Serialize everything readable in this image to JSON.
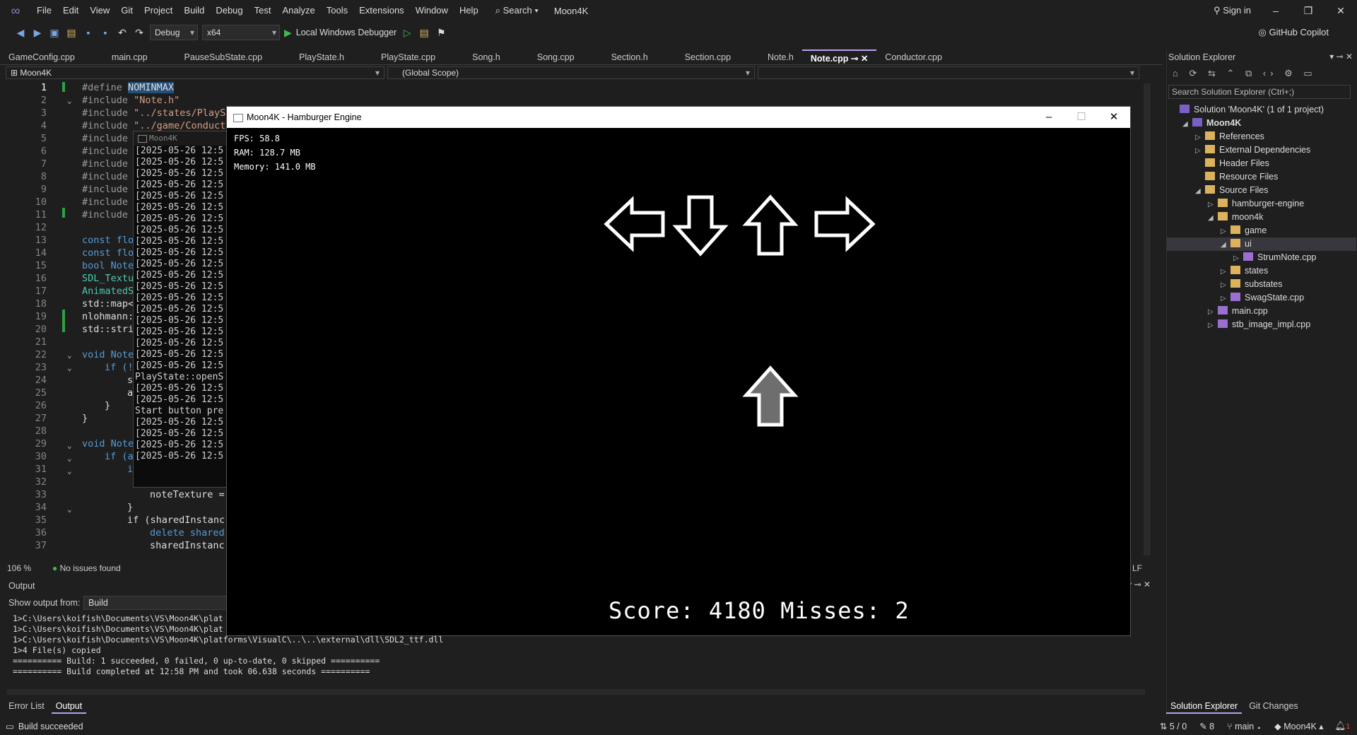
{
  "menu": [
    "File",
    "Edit",
    "View",
    "Git",
    "Project",
    "Build",
    "Debug",
    "Test",
    "Analyze",
    "Tools",
    "Extensions",
    "Window",
    "Help"
  ],
  "search_label": "Search",
  "solution_title": "Moon4K",
  "sign_in": "Sign in",
  "toolbar": {
    "config": "Debug",
    "platform": "x64",
    "debugger": "Local Windows Debugger",
    "copilot": "GitHub Copilot"
  },
  "tabs": [
    "GameConfig.cpp",
    "main.cpp",
    "PauseSubState.cpp",
    "PlayState.h",
    "PlayState.cpp",
    "Song.h",
    "Song.cpp",
    "Section.h",
    "Section.cpp",
    "Note.h",
    "Note.cpp",
    "Conductor.cpp"
  ],
  "active_tab": "Note.cpp",
  "nav": {
    "project": "Moon4K",
    "scope": "(Global Scope)"
  },
  "line_numbers": [
    "1",
    "2",
    "3",
    "4",
    "5",
    "6",
    "7",
    "8",
    "9",
    "10",
    "11",
    "12",
    "13",
    "14",
    "15",
    "16",
    "17",
    "18",
    "19",
    "20",
    "21",
    "22",
    "23",
    "24",
    "25",
    "26",
    "27",
    "28",
    "29",
    "30",
    "31",
    "32",
    "33",
    "34",
    "35",
    "36",
    "37"
  ],
  "code": {
    "l1a": "#define ",
    "l1b": "NOMINMAX",
    "l2": "#include",
    "l2s": "\"Note.h\"",
    "l3": "#include",
    "l3s": "\"../states/PlayS",
    "l4": "#include",
    "l4s": "\"../game/Conduct",
    "inc": "#include",
    "l13": "const flo",
    "l14": "const flo",
    "l15": "bool Note",
    "l16": "SDL_Textu",
    "l17": "AnimatedS",
    "l18": "std::map<",
    "l19": "nlohmann:",
    "l20": "std::stri",
    "l22": "void Note",
    "l23": "if (!",
    "l24": "s",
    "l25": "a",
    "l26": "}",
    "l27": "}",
    "l29": "void Note",
    "l30": "if (a",
    "l31": "i",
    "l33": "noteTexture =",
    "l34": "}",
    "l35": "if (sharedInstanc",
    "l36": "delete shared",
    "l37": "sharedInstanc"
  },
  "status": {
    "zoom": "106 %",
    "issues": "No issues found",
    "eol": "LF"
  },
  "console": {
    "title": "Moon4K",
    "lines": [
      "[2025-05-26 12:5",
      "[2025-05-26 12:5",
      "[2025-05-26 12:5",
      "[2025-05-26 12:5",
      "[2025-05-26 12:5",
      "[2025-05-26 12:5",
      "[2025-05-26 12:5",
      "[2025-05-26 12:5",
      "[2025-05-26 12:5",
      "[2025-05-26 12:5",
      "[2025-05-26 12:5",
      "[2025-05-26 12:5",
      "[2025-05-26 12:5",
      "[2025-05-26 12:5",
      "[2025-05-26 12:5",
      "[2025-05-26 12:5",
      "[2025-05-26 12:5",
      "[2025-05-26 12:5",
      "[2025-05-26 12:5",
      "[2025-05-26 12:5",
      "PlayState::openS",
      "[2025-05-26 12:5",
      "[2025-05-26 12:5",
      "Start button pre",
      "[2025-05-26 12:5",
      "[2025-05-26 12:5",
      "[2025-05-26 12:5",
      "[2025-05-26 12:5"
    ]
  },
  "output": {
    "title": "Output",
    "show_from_label": "Show output from:",
    "source": "Build",
    "lines": [
      "1>C:\\Users\\koifish\\Documents\\VS\\Moon4K\\plat",
      "1>C:\\Users\\koifish\\Documents\\VS\\Moon4K\\plat",
      "1>C:\\Users\\koifish\\Documents\\VS\\Moon4K\\platforms\\VisualC\\..\\..\\external\\dll\\SDL2_ttf.dll",
      "1>4 File(s) copied",
      "========== Build: 1 succeeded, 0 failed, 0 up-to-date, 0 skipped ==========",
      "========== Build completed at 12:58 PM and took 06.638 seconds =========="
    ]
  },
  "bottom_tabs": [
    "Error List",
    "Output"
  ],
  "statusbar": {
    "left": "Build succeeded",
    "lines": "5 / 0",
    "edits": "8",
    "branch": "main",
    "repo": "Moon4K",
    "errors": "1"
  },
  "solution_explorer": {
    "title": "Solution Explorer",
    "search_placeholder": "Search Solution Explorer (Ctrl+;)",
    "items": [
      "Solution 'Moon4K' (1 of 1 project)",
      "Moon4K",
      "References",
      "External Dependencies",
      "Header Files",
      "Resource Files",
      "Source Files",
      "hamburger-engine",
      "moon4k",
      "game",
      "ui",
      "StrumNote.cpp",
      "states",
      "substates",
      "SwagState.cpp",
      "main.cpp",
      "stb_image_impl.cpp"
    ],
    "tabs": [
      "Solution Explorer",
      "Git Changes"
    ]
  },
  "game": {
    "title": "Moon4K - Hamburger Engine",
    "fps": "FPS: 58.8",
    "ram": "RAM: 128.7 MB",
    "memory": "Memory: 141.0 MB",
    "score": "Score: 4180 Misses: 2"
  }
}
